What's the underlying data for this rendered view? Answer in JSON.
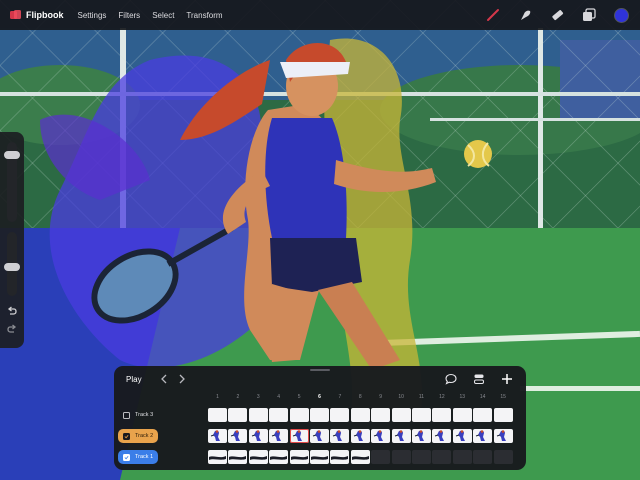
{
  "app": {
    "name": "Flipbook",
    "menu": [
      "Settings",
      "Filters",
      "Select",
      "Transform"
    ],
    "tools": [
      {
        "name": "brush-icon",
        "color": "#d4374a"
      },
      {
        "name": "smudge-icon",
        "color": "#d8d8dc"
      },
      {
        "name": "eraser-icon",
        "color": "#d8d8dc"
      },
      {
        "name": "layers-icon",
        "color": "#d8d8dc"
      }
    ],
    "active_color": "#2f33d9",
    "accent": "#d4374a"
  },
  "sidebar": {
    "slider_icons": [
      "undo-icon"
    ],
    "brush_size_level": 0.12,
    "brush_opacity_level": 0.55
  },
  "timeline": {
    "play_label": "Play",
    "frame_numbers": [
      "1",
      "2",
      "3",
      "4",
      "5",
      "6",
      "7",
      "8",
      "9",
      "10",
      "11",
      "12",
      "13",
      "14",
      "15",
      "16"
    ],
    "current_frame": "6",
    "tracks": [
      {
        "label": "Track 3",
        "checked": false,
        "style": "plain",
        "filled_frames": 16
      },
      {
        "label": "Track 2",
        "checked": true,
        "style": "orange",
        "filled_frames": 16
      },
      {
        "label": "Track 1",
        "checked": true,
        "style": "blue",
        "filled_frames": 8
      }
    ],
    "header_icons": [
      "comment-icon",
      "stack-icon",
      "add-icon"
    ]
  }
}
